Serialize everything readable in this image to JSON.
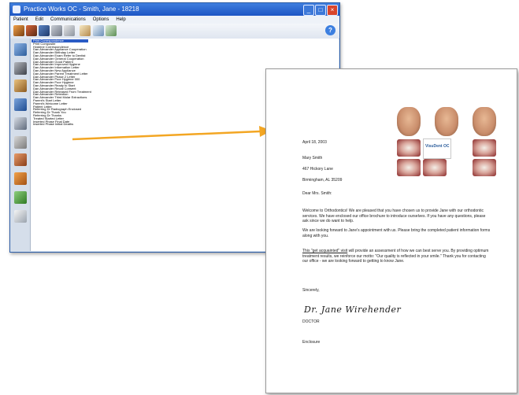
{
  "window": {
    "title": "Practice Works OC - Smith, Jane - 18218",
    "menu": [
      "Patient",
      "Edit",
      "Communications",
      "Options",
      "Help"
    ],
    "controls": {
      "minimize": "_",
      "maximize": "□",
      "close": "×"
    },
    "help_glyph": "?"
  },
  "letter_list": {
    "items": [
      "Print Correspondence",
      "Print Composite",
      "Hygiene Correspondence",
      "Dan Alexander Appliance Cooperation",
      "Dan Alexander Birthday Letter",
      "Dan Alexander Exam Refer to Dentist",
      "Dan Alexander General Cooperation",
      "Dan Alexander Good Patient",
      "Dan Alexander Improved Hygiene",
      "Dan Alexander Information Letter",
      "Dan Alexander New Appliance",
      "Dan Alexander Parent Treatment Letter",
      "Dan Alexander Phase 2 Letter",
      "Dan Alexander Poor Hygiene 000",
      "Dan Alexander Poor Hygiene",
      "Dan Alexander Ready to Start",
      "Dan Alexander Recall Consent",
      "Dan Alexander Released From Treatment",
      "Dan Alexander Retention",
      "Dan Alexander Third Molar Extractions",
      "Parent's Start Letter",
      "Parent's Welcome Letter",
      "Patient Letter",
      "Referring Dr Radiograph Enclosed",
      "Referring Dr Thank You",
      "Referring Dr Thanks",
      "Treated Started Letter",
      "Inserted Phase Final Date",
      "Inserted Phase Initial Deaths"
    ],
    "selected_index": 0
  },
  "letter": {
    "date": "April 18, 2003",
    "recipient": {
      "name": "Mary Smith",
      "street": "467 Hickory Lane",
      "city": "Birmingham, AL 35209"
    },
    "salutation": "Dear Mrs. Smith:",
    "paragraph1": "Welcome to Orthodontics! We are pleased that you have chosen us to provide Jane with our orthodontic services. We have enclosed our office brochure to introduce ourselves. If you have any questions, please ask since we do want to help.",
    "paragraph2": "We are looking forward to Jane's appointment with us. Please bring the completed patient information forms along with you.",
    "paragraph3_lead": "This \"get acquainted\" visit",
    "paragraph3_rest": " will provide an assessment of how we can best serve you. By providing optimum treatment results, we reinforce our motto: \"Our quality is reflected in your smile.\" Thank you for contacting our office - we are looking forward to getting to know Jane.",
    "closing": "Sincerely,",
    "signature": "Dr. Jane Wirehender",
    "title": "DOCTOR",
    "enclosure": "Enclosure",
    "logo_text": "VisuDent OC"
  }
}
